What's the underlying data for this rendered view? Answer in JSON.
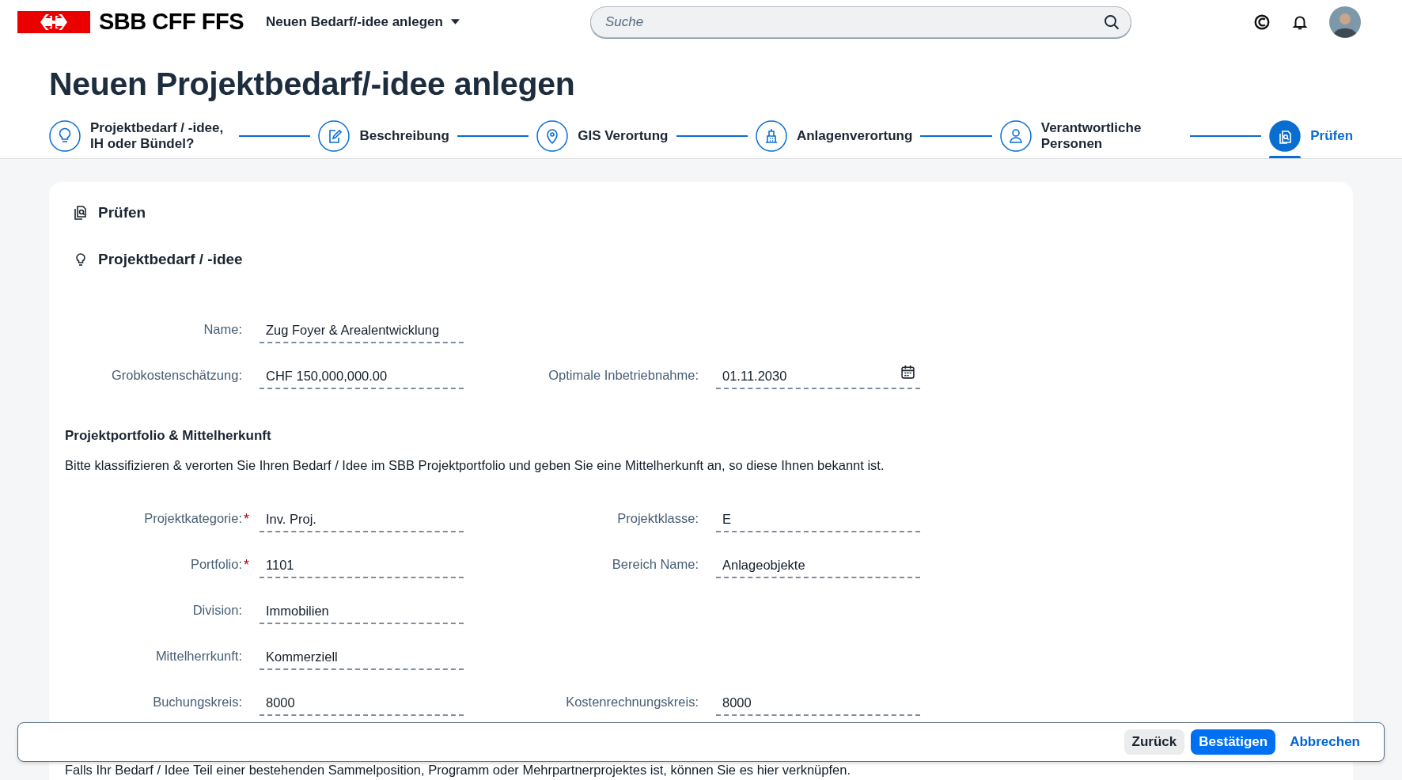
{
  "header": {
    "logo_text": "SBB CFF FFS",
    "app_title": "Neuen Bedarf/-idee anlegen",
    "search": {
      "placeholder": "Suche"
    }
  },
  "page_title": "Neuen Projektbedarf/-idee anlegen",
  "steps": [
    {
      "label": "Projektbedarf / -idee, IH oder Bündel?",
      "selected": false
    },
    {
      "label": "Beschreibung",
      "selected": false
    },
    {
      "label": "GIS Verortung",
      "selected": false
    },
    {
      "label": "Anlagenverortung",
      "selected": false
    },
    {
      "label": "Verantwortliche Personen",
      "selected": false
    },
    {
      "label": "Prüfen",
      "selected": true
    }
  ],
  "card": {
    "heading": "Prüfen",
    "subheading": "Projektbedarf / -idee",
    "rows": [
      {
        "left": {
          "label": "Name:",
          "value": "Zug Foyer & Arealentwicklung"
        }
      },
      {
        "left": {
          "label": "Grobkostenschätzung:",
          "value": "CHF 150,000,000.00"
        },
        "right": {
          "label": "Optimale Inbetriebnahme:",
          "value": "01.11.2030",
          "kind": "date"
        }
      }
    ],
    "section": {
      "title": "Projektportfolio & Mittelherkunft",
      "description": "Bitte klassifizieren & verorten Sie Ihren Bedarf / Idee im SBB Projektportfolio und geben Sie eine Mittelherkunft an, so diese Ihnen bekannt ist.",
      "rows": [
        {
          "left": {
            "label": "Projektkategorie:",
            "required_mark": "*",
            "value": "Inv. Proj."
          },
          "right": {
            "label": "Projektklasse:",
            "value": "E"
          }
        },
        {
          "left": {
            "label": "Portfolio:",
            "required_mark": "*",
            "value": "1101"
          },
          "right": {
            "label": "Bereich Name:",
            "value": "Anlageobjekte"
          }
        },
        {
          "left": {
            "label": "Division:",
            "value": "Immobilien"
          }
        },
        {
          "left": {
            "label": "Mittelherrkunft:",
            "value": "Kommerziell"
          }
        },
        {
          "left": {
            "label": "Buchungskreis:",
            "value": "8000"
          },
          "right": {
            "label": "Kostenrechnungskreis:",
            "value": "8000"
          }
        }
      ]
    },
    "note": "Falls Ihr Bedarf / Idee Teil einer bestehenden Sammelposition, Programm oder Mehrpartnerprojektes ist, können Sie es hier verknüpfen."
  },
  "footer": {
    "buttons": [
      {
        "label": "Zurück",
        "kind": "secondary"
      },
      {
        "label": "Bestätigen",
        "kind": "primary"
      },
      {
        "label": "Abbrechen",
        "kind": "link"
      }
    ]
  }
}
